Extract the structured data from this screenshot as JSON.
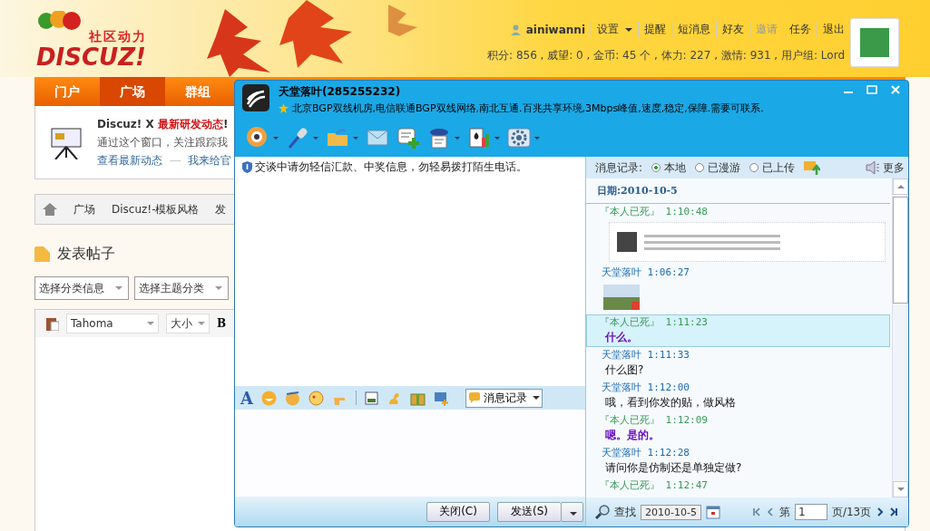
{
  "header": {
    "logo_tagline": "社区动力",
    "logo_text": "DISCUZ!",
    "user": "ainiwanni",
    "links": [
      {
        "label": "设置",
        "kind": "menu"
      },
      {
        "label": "提醒",
        "kind": "link"
      },
      {
        "label": "短消息",
        "kind": "link"
      },
      {
        "label": "好友",
        "kind": "link"
      },
      {
        "label": "邀请",
        "kind": "dim"
      },
      {
        "label": "任务",
        "kind": "link"
      },
      {
        "label": "退出",
        "kind": "link"
      }
    ],
    "stats": "积分: 856 , 威望: 0 , 金币: 45 个 , 体力: 227 , 激情: 931 , 用户组: Lord"
  },
  "nav": [
    {
      "label": "门户",
      "selected": false
    },
    {
      "label": "广场",
      "selected": true
    },
    {
      "label": "群组",
      "selected": false
    }
  ],
  "notice": {
    "title_prefix": "Discuz! X ",
    "title_highlight": "最新研发动态",
    "title_suffix": "!",
    "body": "通过这个窗口，关注跟踪我",
    "links": [
      "查看最新动态",
      "我来给官"
    ]
  },
  "breadcrumb": [
    "广场",
    "Discuz!-模板风格",
    "发"
  ],
  "post": {
    "heading": "发表帖子",
    "selects": [
      "选择分类信息",
      "选择主题分类"
    ],
    "font": "Tahoma",
    "size": "大小",
    "bold": "B"
  },
  "chat": {
    "title": "天堂落叶(285255232)",
    "signature": "北京BGP双线机房,电信联通BGP双线网络,南北互通.百兆共享环境,3Mbps峰值,速度,稳定,保障.需要可联系.",
    "warning": "交谈中请勿轻信汇款、中奖信息，勿轻易拨打陌生电话。",
    "font_button": "A",
    "record_button": "消息记录",
    "close_button": "关闭(C)",
    "send_button": "发送(S)",
    "history_label": "消息记录:",
    "history_sources": [
      {
        "label": "本地",
        "selected": true
      },
      {
        "label": "已漫游",
        "selected": false
      },
      {
        "label": "已上传",
        "selected": false
      }
    ],
    "more": "更多",
    "date": "日期:2010-10-5",
    "messages": [
      {
        "sender": "『本人已死』",
        "time": "1:10:48",
        "self": true,
        "kind": "screenshot",
        "selected": false
      },
      {
        "sender": "天堂落叶",
        "time": "1:06:27",
        "self": false,
        "kind": "broken-image",
        "selected": false
      },
      {
        "sender": "『本人已死』",
        "time": "1:11:23",
        "self": true,
        "kind": "text",
        "text": "什么。",
        "selected": true
      },
      {
        "sender": "天堂落叶",
        "time": "1:11:33",
        "self": false,
        "kind": "text",
        "text": "什么图?",
        "selected": false
      },
      {
        "sender": "天堂落叶",
        "time": "1:12:00",
        "self": false,
        "kind": "text",
        "text": "哦，看到你发的贴，做风格",
        "selected": false
      },
      {
        "sender": "『本人已死』",
        "time": "1:12:09",
        "self": true,
        "kind": "text",
        "text": "嗯。是的。",
        "selected": false
      },
      {
        "sender": "天堂落叶",
        "time": "1:12:28",
        "self": false,
        "kind": "text",
        "text": "请问你是仿制还是单独定做?",
        "selected": false
      },
      {
        "sender": "『本人已死』",
        "time": "1:12:47",
        "self": true,
        "kind": "none",
        "selected": false
      }
    ],
    "search_label": "查找",
    "search_date": "2010-10-5",
    "page_prefix": "第",
    "page": "1",
    "page_suffix": "页/13页"
  }
}
